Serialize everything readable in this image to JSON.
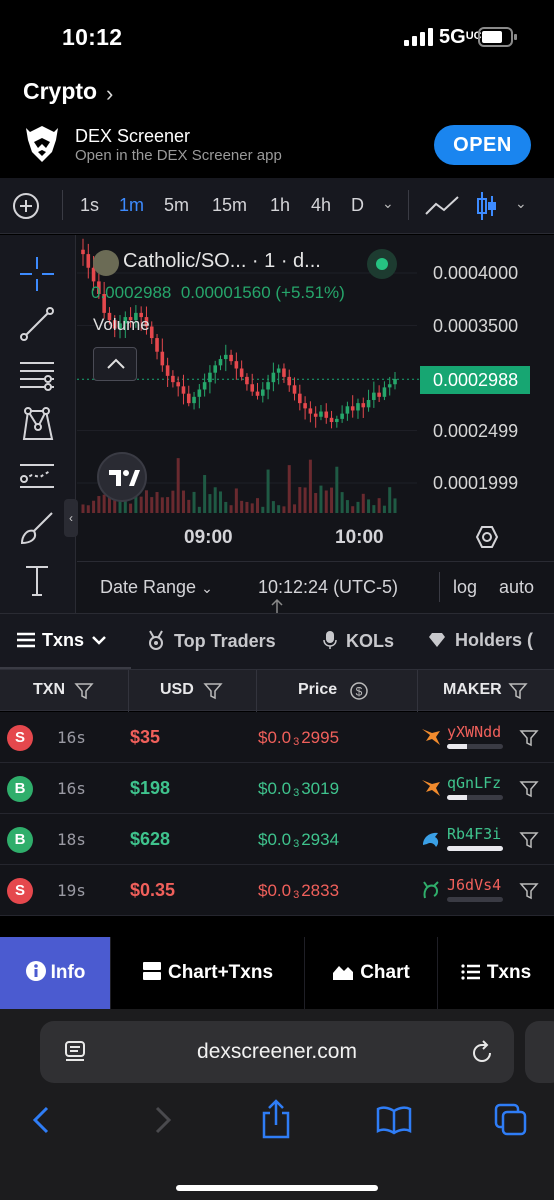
{
  "status_bar": {
    "time": "10:12",
    "network": "5G",
    "network_suffix": "UC"
  },
  "back_to_app": {
    "label": "Crypto"
  },
  "app_banner": {
    "title": "DEX Screener",
    "subtitle": "Open in the DEX Screener app",
    "open_label": "OPEN"
  },
  "timeframes": [
    {
      "label": "1s",
      "active": false
    },
    {
      "label": "1m",
      "active": true
    },
    {
      "label": "5m",
      "active": false
    },
    {
      "label": "15m",
      "active": false
    },
    {
      "label": "1h",
      "active": false
    },
    {
      "label": "4h",
      "active": false
    },
    {
      "label": "D",
      "active": false
    }
  ],
  "chart": {
    "legend_title": "Catholic/SO... · 1 · d...",
    "legend_price": "0.0002988",
    "legend_change": "0.00001560 (+5.51%)",
    "volume_label": "Volume",
    "price_levels": [
      "0.0004000",
      "0.0003500",
      "0.0002988",
      "0.0002499",
      "0.0001999"
    ],
    "current_price": "0.0002988",
    "time_labels": [
      "09:00",
      "10:00"
    ],
    "date_range_label": "Date Range",
    "clock": "10:12:24 (UTC-5)",
    "log_label": "log",
    "auto_label": "auto"
  },
  "chart_data": {
    "type": "candlestick",
    "interval": "1m",
    "y_range": [
      0.00018,
      0.00042
    ],
    "y_ticks": [
      0.0004,
      0.00035,
      0.0002988,
      0.0002499,
      0.0001999
    ],
    "x_ticks": [
      "09:00",
      "10:00"
    ],
    "last_price": 0.0002988,
    "close_path": [
      0.000418,
      0.000405,
      0.000392,
      0.00038,
      0.000362,
      0.000355,
      0.000347,
      0.000352,
      0.000358,
      0.000355,
      0.000362,
      0.000358,
      0.000349,
      0.000338,
      0.000325,
      0.000312,
      0.000302,
      0.000296,
      0.000292,
      0.000285,
      0.000276,
      0.000282,
      0.000289,
      0.000296,
      0.000305,
      0.000312,
      0.000318,
      0.000322,
      0.000316,
      0.000309,
      0.000301,
      0.000294,
      0.000287,
      0.000283,
      0.000289,
      0.000296,
      0.000305,
      0.000309,
      0.000301,
      0.000293,
      0.000285,
      0.000276,
      0.000271,
      0.000266,
      0.000263,
      0.000268,
      0.000262,
      0.000258,
      0.000261,
      0.000266,
      0.000273,
      0.000269,
      0.000276,
      0.000272,
      0.000279,
      0.000286,
      0.000282,
      0.000291,
      0.000294,
      0.000299
    ]
  },
  "tabs": [
    {
      "label": "Txns",
      "active": true
    },
    {
      "label": "Top Traders",
      "active": false
    },
    {
      "label": "KOLs",
      "active": false
    },
    {
      "label": "Holders (",
      "active": false
    }
  ],
  "table": {
    "headers": [
      "TXN",
      "USD",
      "Price",
      "MAKER"
    ],
    "rows": [
      {
        "side": "S",
        "type": "sell",
        "age": "16s",
        "usd": "$35",
        "price_prefix": "$0.0",
        "price_zeros": "3",
        "price_digits": "2995",
        "maker": "yXWNdd",
        "maker_icon": "fox-icon",
        "maker_bar": 0.35
      },
      {
        "side": "B",
        "type": "buy",
        "age": "16s",
        "usd": "$198",
        "price_prefix": "$0.0",
        "price_zeros": "3",
        "price_digits": "3019",
        "maker": "qGnLFz",
        "maker_icon": "fox-icon",
        "maker_bar": 0.35
      },
      {
        "side": "B",
        "type": "buy",
        "age": "18s",
        "usd": "$628",
        "price_prefix": "$0.0",
        "price_zeros": "3",
        "price_digits": "2934",
        "maker": "Rb4F3i",
        "maker_icon": "dolphin-icon",
        "maker_bar": 1.0
      },
      {
        "side": "S",
        "type": "sell",
        "age": "19s",
        "usd": "$0.35",
        "price_prefix": "$0.0",
        "price_zeros": "3",
        "price_digits": "2833",
        "maker": "J6dVs4",
        "maker_icon": "shrimp-icon",
        "maker_bar": 0.0
      }
    ]
  },
  "bottom_nav": [
    {
      "label": "Info",
      "active": true
    },
    {
      "label": "Chart+Txns",
      "active": false
    },
    {
      "label": "Chart",
      "active": false
    },
    {
      "label": "Txns",
      "active": false
    }
  ],
  "browser": {
    "url": "dexscreener.com"
  },
  "colors": {
    "accent_blue": "#3d8bff",
    "buy": "#3fc38d",
    "sell": "#f0605b",
    "price_tag": "#17a672",
    "info_active": "#4b5bd0"
  }
}
